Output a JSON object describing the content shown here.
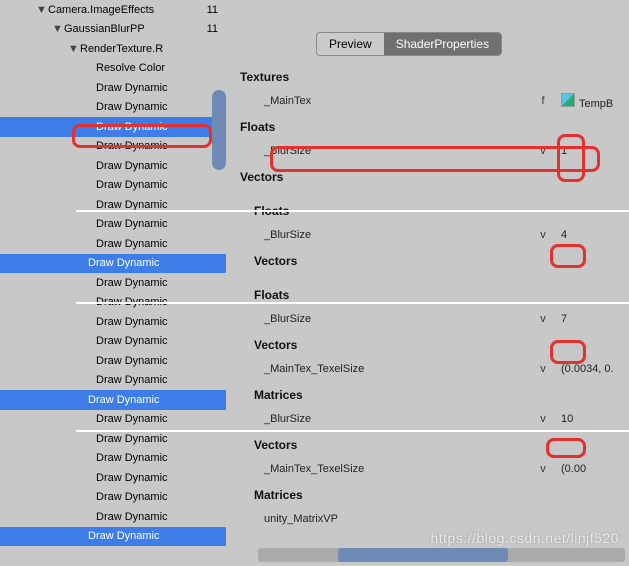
{
  "tree": {
    "items": [
      {
        "label": "Camera.ImageEffects",
        "indent": 36,
        "disclosure": "▼",
        "count": "11",
        "sel": false
      },
      {
        "label": "GaussianBlurPP",
        "indent": 52,
        "disclosure": "▼",
        "count": "11",
        "sel": false
      },
      {
        "label": "RenderTexture.R",
        "indent": 68,
        "disclosure": "▼",
        "count": "",
        "sel": false
      },
      {
        "label": "Resolve Color",
        "indent": 84,
        "disclosure": "",
        "count": "",
        "sel": false
      },
      {
        "label": "Draw Dynamic",
        "indent": 84,
        "disclosure": "",
        "count": "",
        "sel": false
      },
      {
        "label": "Draw Dynamic",
        "indent": 84,
        "disclosure": "",
        "count": "",
        "sel": false
      },
      {
        "label": "Draw Dynamic",
        "indent": 84,
        "disclosure": "",
        "count": "",
        "sel": true
      },
      {
        "label": "Draw Dynamic",
        "indent": 84,
        "disclosure": "",
        "count": "",
        "sel": false
      },
      {
        "label": "Draw Dynamic",
        "indent": 84,
        "disclosure": "",
        "count": "",
        "sel": false
      },
      {
        "label": "Draw Dynamic",
        "indent": 84,
        "disclosure": "",
        "count": "",
        "sel": false
      },
      {
        "label": "Draw Dynamic",
        "indent": 84,
        "disclosure": "",
        "count": "",
        "sel": false
      },
      {
        "label": "Draw Dynamic",
        "indent": 84,
        "disclosure": "",
        "count": "",
        "sel": false
      },
      {
        "label": "Draw Dynamic",
        "indent": 84,
        "disclosure": "",
        "count": "",
        "sel": false
      },
      {
        "label": "Draw Dynamic",
        "indent": 76,
        "disclosure": "",
        "count": "",
        "sel": true
      },
      {
        "label": "Draw Dynamic",
        "indent": 84,
        "disclosure": "",
        "count": "",
        "sel": false
      },
      {
        "label": "Draw Dynamic",
        "indent": 84,
        "disclosure": "",
        "count": "",
        "sel": false
      },
      {
        "label": "Draw Dynamic",
        "indent": 84,
        "disclosure": "",
        "count": "",
        "sel": false
      },
      {
        "label": "Draw Dynamic",
        "indent": 84,
        "disclosure": "",
        "count": "",
        "sel": false
      },
      {
        "label": "Draw Dynamic",
        "indent": 84,
        "disclosure": "",
        "count": "",
        "sel": false
      },
      {
        "label": "Draw Dynamic",
        "indent": 84,
        "disclosure": "",
        "count": "",
        "sel": false
      },
      {
        "label": "Draw Dynamic",
        "indent": 76,
        "disclosure": "",
        "count": "",
        "sel": true
      },
      {
        "label": "Draw Dynamic",
        "indent": 84,
        "disclosure": "",
        "count": "",
        "sel": false
      },
      {
        "label": "Draw Dynamic",
        "indent": 84,
        "disclosure": "",
        "count": "",
        "sel": false
      },
      {
        "label": "Draw Dynamic",
        "indent": 84,
        "disclosure": "",
        "count": "",
        "sel": false
      },
      {
        "label": "Draw Dynamic",
        "indent": 84,
        "disclosure": "",
        "count": "",
        "sel": false
      },
      {
        "label": "Draw Dynamic",
        "indent": 84,
        "disclosure": "",
        "count": "",
        "sel": false
      },
      {
        "label": "Draw Dynamic",
        "indent": 84,
        "disclosure": "",
        "count": "",
        "sel": false
      },
      {
        "label": "Draw Dynamic",
        "indent": 76,
        "disclosure": "",
        "count": "",
        "sel": true
      }
    ]
  },
  "tabs": {
    "preview": "Preview",
    "shader": "ShaderProperties"
  },
  "sections": {
    "s1": {
      "textures": "Textures",
      "maintex": {
        "name": "_MainTex",
        "type": "f",
        "val": "TempB"
      },
      "floats": "Floats",
      "blursize": {
        "name": "_BlurSize",
        "type": "v",
        "val": "1"
      },
      "vectors": "Vectors"
    },
    "s2": {
      "floats": "Floats",
      "blursize": {
        "name": "_BlurSize",
        "type": "v",
        "val": "4"
      },
      "vectors": "Vectors"
    },
    "s3": {
      "floats": "Floats",
      "blursize": {
        "name": "_BlurSize",
        "type": "v",
        "val": "7"
      },
      "vectors": "Vectors",
      "texel": {
        "name": "_MainTex_TexelSize",
        "type": "v",
        "val": "(0.0034, 0."
      },
      "matrices": "Matrices"
    },
    "s4": {
      "blursize": {
        "name": "_BlurSize",
        "type": "v",
        "val": "10"
      },
      "vectors": "Vectors",
      "texel": {
        "name": "_MainTex_TexelSize",
        "type": "v",
        "val": "(0.00"
      },
      "matrices": "Matrices",
      "matvp": {
        "name": "unity_MatrixVP",
        "type": "",
        "val": ""
      }
    }
  },
  "watermark": "https://blog.csdn.net/linjf520"
}
